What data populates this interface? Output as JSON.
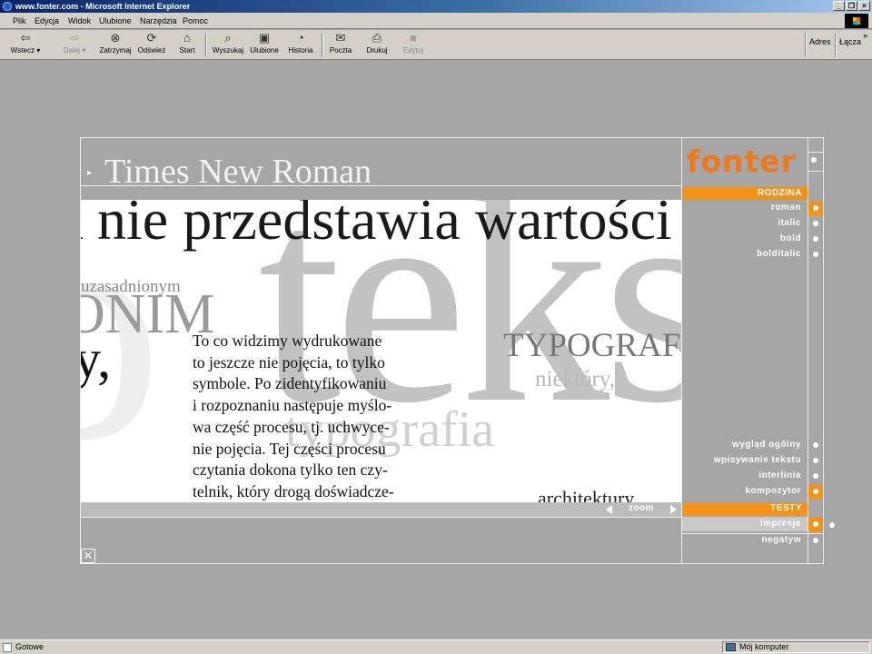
{
  "window": {
    "title": "www.fonter.com - Microsoft Internet Explorer"
  },
  "menu": {
    "items": [
      "Plik",
      "Edycja",
      "Widok",
      "Ulubione",
      "Narzędzia",
      "Pomoc"
    ]
  },
  "toolbar": {
    "buttons": [
      {
        "label": "Wstecz",
        "icon": "back-arrow-icon",
        "enabled": true
      },
      {
        "label": "Dalej",
        "icon": "forward-arrow-icon",
        "enabled": false
      },
      {
        "label": "Zatrzymaj",
        "icon": "stop-icon",
        "enabled": true
      },
      {
        "label": "Odśwież",
        "icon": "refresh-icon",
        "enabled": true
      },
      {
        "label": "Start",
        "icon": "home-icon",
        "enabled": true
      },
      {
        "label": "Wyszukaj",
        "icon": "search-icon",
        "enabled": true
      },
      {
        "label": "Ulubione",
        "icon": "favorites-icon",
        "enabled": true
      },
      {
        "label": "Historia",
        "icon": "history-icon",
        "enabled": true
      },
      {
        "label": "Poczta",
        "icon": "mail-icon",
        "enabled": true
      },
      {
        "label": "Drukuj",
        "icon": "print-icon",
        "enabled": true
      },
      {
        "label": "Edytuj",
        "icon": "edit-icon",
        "enabled": false
      }
    ],
    "address_label": "Adres",
    "links_label": "Łącza",
    "chevron": "»"
  },
  "page": {
    "title": "Times New Roman",
    "arrow": "▸",
    "preview": {
      "big_letters": "tekst",
      "huge_o": "o",
      "line1": "k nie przedstawia wartości",
      "small1": "uzasadnionym",
      "onim": "ONIM",
      "y": "y,",
      "typo": "TYPOGRAFIA",
      "niektory": "niektóry,",
      "typografia": "typografia",
      "architektury": "architektury",
      "paragraph": [
        "To co widzimy wydrukowane",
        "to jeszcze nie pojęcia, to tylko",
        "symbole. Po zidentyfikowaniu",
        "i rozpoznaniu następuje myślo-",
        "wa część procesu, tj. uchwyce-",
        "nie pojęcia. Tej części procesu",
        "czytania dokona tylko ten czy-",
        "telnik, który drogą doświadcze-"
      ]
    },
    "zoom_label": "zoom",
    "close_symbol": "✕"
  },
  "sidebar": {
    "logo": "fonter",
    "section_rodzina": "RODZINA",
    "rodzina_items": [
      {
        "label": "roman",
        "active": true
      },
      {
        "label": "italic",
        "active": false
      },
      {
        "label": "bold",
        "active": false
      },
      {
        "label": "bolditalic",
        "active": false
      }
    ],
    "view_items": [
      {
        "label": "wygląd ogólny",
        "active": false
      },
      {
        "label": "wpisywanie tekstu",
        "active": false
      },
      {
        "label": "interlinia",
        "active": false
      },
      {
        "label": "kompozytor",
        "active": true
      }
    ],
    "section_testy": "TESTY",
    "testy_items": [
      {
        "label": "impresje",
        "active": true
      },
      {
        "label": "negatyw",
        "active": false
      }
    ]
  },
  "status": {
    "left": "Gotowe",
    "zone": "Mój komputer"
  },
  "colors": {
    "accent": "#f29216",
    "logo": "#ec7a1d",
    "page_bg": "#a6a6a6"
  }
}
